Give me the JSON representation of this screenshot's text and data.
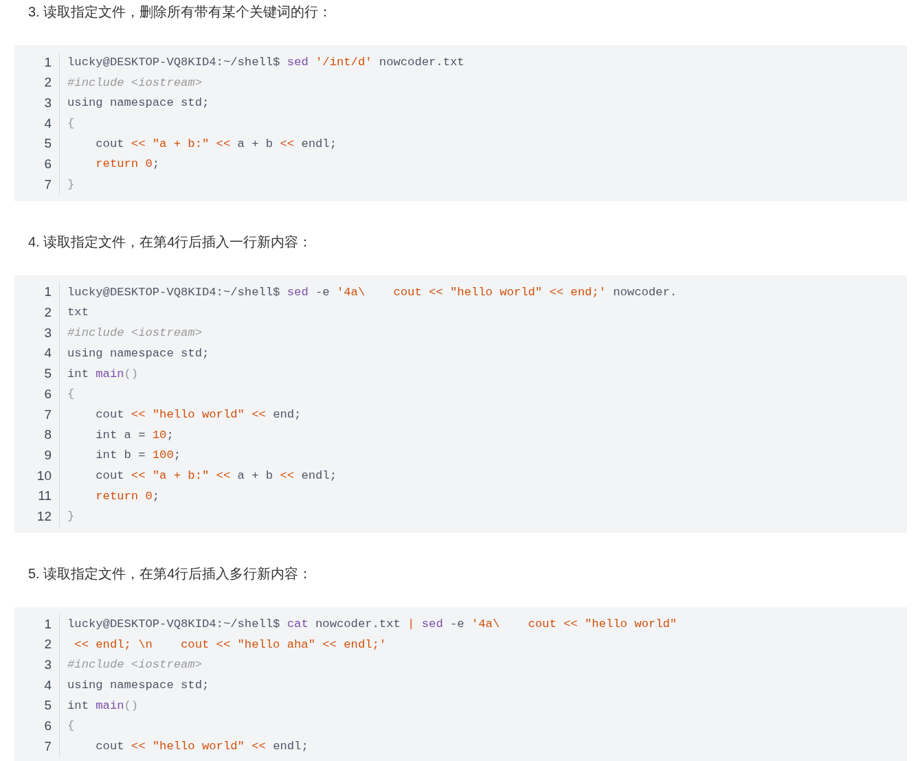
{
  "sections": [
    {
      "heading": "3. 读取指定文件，删除所有带有某个关键词的行：",
      "lines": [
        {
          "number": "1",
          "tokens": [
            {
              "text": "lucky@DESKTOP-VQ8KID4:~/shell$ ",
              "kind": "plain"
            },
            {
              "text": "sed ",
              "kind": "keyword"
            },
            {
              "text": "'/int/d'",
              "kind": "string"
            },
            {
              "text": " nowcoder.txt",
              "kind": "plain"
            }
          ]
        },
        {
          "number": "2",
          "tokens": [
            {
              "text": "#include <iostream>",
              "kind": "comment"
            }
          ]
        },
        {
          "number": "3",
          "tokens": [
            {
              "text": "using namespace std;",
              "kind": "plain"
            }
          ]
        },
        {
          "number": "4",
          "tokens": [
            {
              "text": "{",
              "kind": "punct"
            }
          ]
        },
        {
          "number": "5",
          "tokens": [
            {
              "text": "    cout ",
              "kind": "plain"
            },
            {
              "text": "<< \"a + b:\" <<",
              "kind": "string"
            },
            {
              "text": " a + b ",
              "kind": "plain"
            },
            {
              "text": "<<",
              "kind": "string"
            },
            {
              "text": " endl;",
              "kind": "plain"
            }
          ]
        },
        {
          "number": "6",
          "tokens": [
            {
              "text": "    return 0",
              "kind": "string"
            },
            {
              "text": ";",
              "kind": "plain"
            }
          ]
        },
        {
          "number": "7",
          "tokens": [
            {
              "text": "}",
              "kind": "punct"
            }
          ]
        }
      ]
    },
    {
      "heading": "4. 读取指定文件，在第4行后插入一行新内容：",
      "lines": [
        {
          "number": "1",
          "tokens": [
            {
              "text": "lucky@DESKTOP-VQ8KID4:~/shell$ ",
              "kind": "plain"
            },
            {
              "text": "sed",
              "kind": "keyword"
            },
            {
              "text": " -e ",
              "kind": "plain"
            },
            {
              "text": "'4a\\    cout << \"hello world\" << end;'",
              "kind": "string"
            },
            {
              "text": " nowcoder.",
              "kind": "plain"
            }
          ]
        },
        {
          "number": "2",
          "tokens": [
            {
              "text": "txt",
              "kind": "plain"
            }
          ]
        },
        {
          "number": "3",
          "tokens": [
            {
              "text": "#include <iostream>",
              "kind": "comment"
            }
          ]
        },
        {
          "number": "4",
          "tokens": [
            {
              "text": "using namespace std;",
              "kind": "plain"
            }
          ]
        },
        {
          "number": "5",
          "tokens": [
            {
              "text": "int ",
              "kind": "plain"
            },
            {
              "text": "main",
              "kind": "keyword"
            },
            {
              "text": "()",
              "kind": "punct"
            }
          ]
        },
        {
          "number": "6",
          "tokens": [
            {
              "text": "{",
              "kind": "punct"
            }
          ]
        },
        {
          "number": "7",
          "tokens": [
            {
              "text": "    cout ",
              "kind": "plain"
            },
            {
              "text": "<< \"hello world\" <<",
              "kind": "string"
            },
            {
              "text": " end;",
              "kind": "plain"
            }
          ]
        },
        {
          "number": "8",
          "tokens": [
            {
              "text": "    int a = ",
              "kind": "plain"
            },
            {
              "text": "10",
              "kind": "string"
            },
            {
              "text": ";",
              "kind": "plain"
            }
          ]
        },
        {
          "number": "9",
          "tokens": [
            {
              "text": "    int b = ",
              "kind": "plain"
            },
            {
              "text": "100",
              "kind": "string"
            },
            {
              "text": ";",
              "kind": "plain"
            }
          ]
        },
        {
          "number": "10",
          "tokens": [
            {
              "text": "    cout ",
              "kind": "plain"
            },
            {
              "text": "<< \"a + b:\" <<",
              "kind": "string"
            },
            {
              "text": " a + b ",
              "kind": "plain"
            },
            {
              "text": "<<",
              "kind": "string"
            },
            {
              "text": " endl;",
              "kind": "plain"
            }
          ]
        },
        {
          "number": "11",
          "tokens": [
            {
              "text": "    return 0",
              "kind": "string"
            },
            {
              "text": ";",
              "kind": "plain"
            }
          ]
        },
        {
          "number": "12",
          "tokens": [
            {
              "text": "}",
              "kind": "punct"
            }
          ]
        }
      ]
    },
    {
      "heading": "5. 读取指定文件，在第4行后插入多行新内容：",
      "lines": [
        {
          "number": "1",
          "tokens": [
            {
              "text": "lucky@DESKTOP-VQ8KID4:~/shell$ ",
              "kind": "plain"
            },
            {
              "text": "cat",
              "kind": "keyword"
            },
            {
              "text": " nowcoder.txt ",
              "kind": "plain"
            },
            {
              "text": "| ",
              "kind": "string"
            },
            {
              "text": "sed",
              "kind": "keyword"
            },
            {
              "text": " -e ",
              "kind": "plain"
            },
            {
              "text": "'4a\\    cout << \"hello world\"",
              "kind": "string"
            }
          ]
        },
        {
          "number": "2",
          "tokens": [
            {
              "text": " << endl; \\n    cout << \"hello aha\" << endl;'",
              "kind": "string"
            }
          ]
        },
        {
          "number": "3",
          "tokens": [
            {
              "text": "#include <iostream>",
              "kind": "comment"
            }
          ]
        },
        {
          "number": "4",
          "tokens": [
            {
              "text": "using namespace std;",
              "kind": "plain"
            }
          ]
        },
        {
          "number": "5",
          "tokens": [
            {
              "text": "int ",
              "kind": "plain"
            },
            {
              "text": "main",
              "kind": "keyword"
            },
            {
              "text": "()",
              "kind": "punct"
            }
          ]
        },
        {
          "number": "6",
          "tokens": [
            {
              "text": "{",
              "kind": "punct"
            }
          ]
        },
        {
          "number": "7",
          "tokens": [
            {
              "text": "    cout ",
              "kind": "plain"
            },
            {
              "text": "<< \"hello world\" <<",
              "kind": "string"
            },
            {
              "text": " endl;",
              "kind": "plain"
            }
          ]
        }
      ]
    }
  ]
}
